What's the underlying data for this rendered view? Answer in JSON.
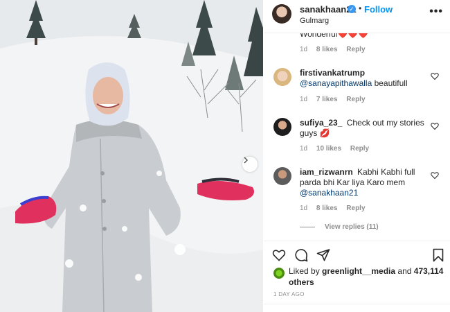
{
  "post": {
    "username": "sanakhaan21",
    "follow_label": "Follow",
    "location": "Gulmarg",
    "more_label": "•••"
  },
  "comments": {
    "partial": {
      "text": "Wonderful❤️❤️❤️",
      "time": "1d",
      "likes": "8 likes",
      "reply": "Reply"
    },
    "items": [
      {
        "username": "firstivankatrump",
        "mention": "@sanayapithawalla",
        "text": " beautifull",
        "time": "1d",
        "likes": "7 likes",
        "reply": "Reply"
      },
      {
        "username": "sufiya_23_",
        "text": "Check out my stories guys 💋",
        "time": "1d",
        "likes": "10 likes",
        "reply": "Reply"
      },
      {
        "username": "iam_rizwanrn",
        "text": "Kabhi Kabhi full parda bhi Kar liya Karo mem ",
        "mention": "@sanakhaan21",
        "time": "1d",
        "likes": "8 likes",
        "reply": "Reply"
      }
    ],
    "view_replies": "View replies (11)"
  },
  "likes_summary": {
    "prefix": "Liked by ",
    "user": "greenlight__media",
    "middle": " and ",
    "others": "473,114 others"
  },
  "timestamp": "1 DAY AGO",
  "icons": {
    "like": "heart-icon",
    "comment": "comment-icon",
    "share": "share-icon",
    "save": "bookmark-icon",
    "next": "chevron-right-icon",
    "verified": "verified-badge-icon"
  },
  "colors": {
    "accent": "#0095f6",
    "text": "#262626",
    "muted": "#8e8e8e",
    "glove": "#e0305e"
  }
}
